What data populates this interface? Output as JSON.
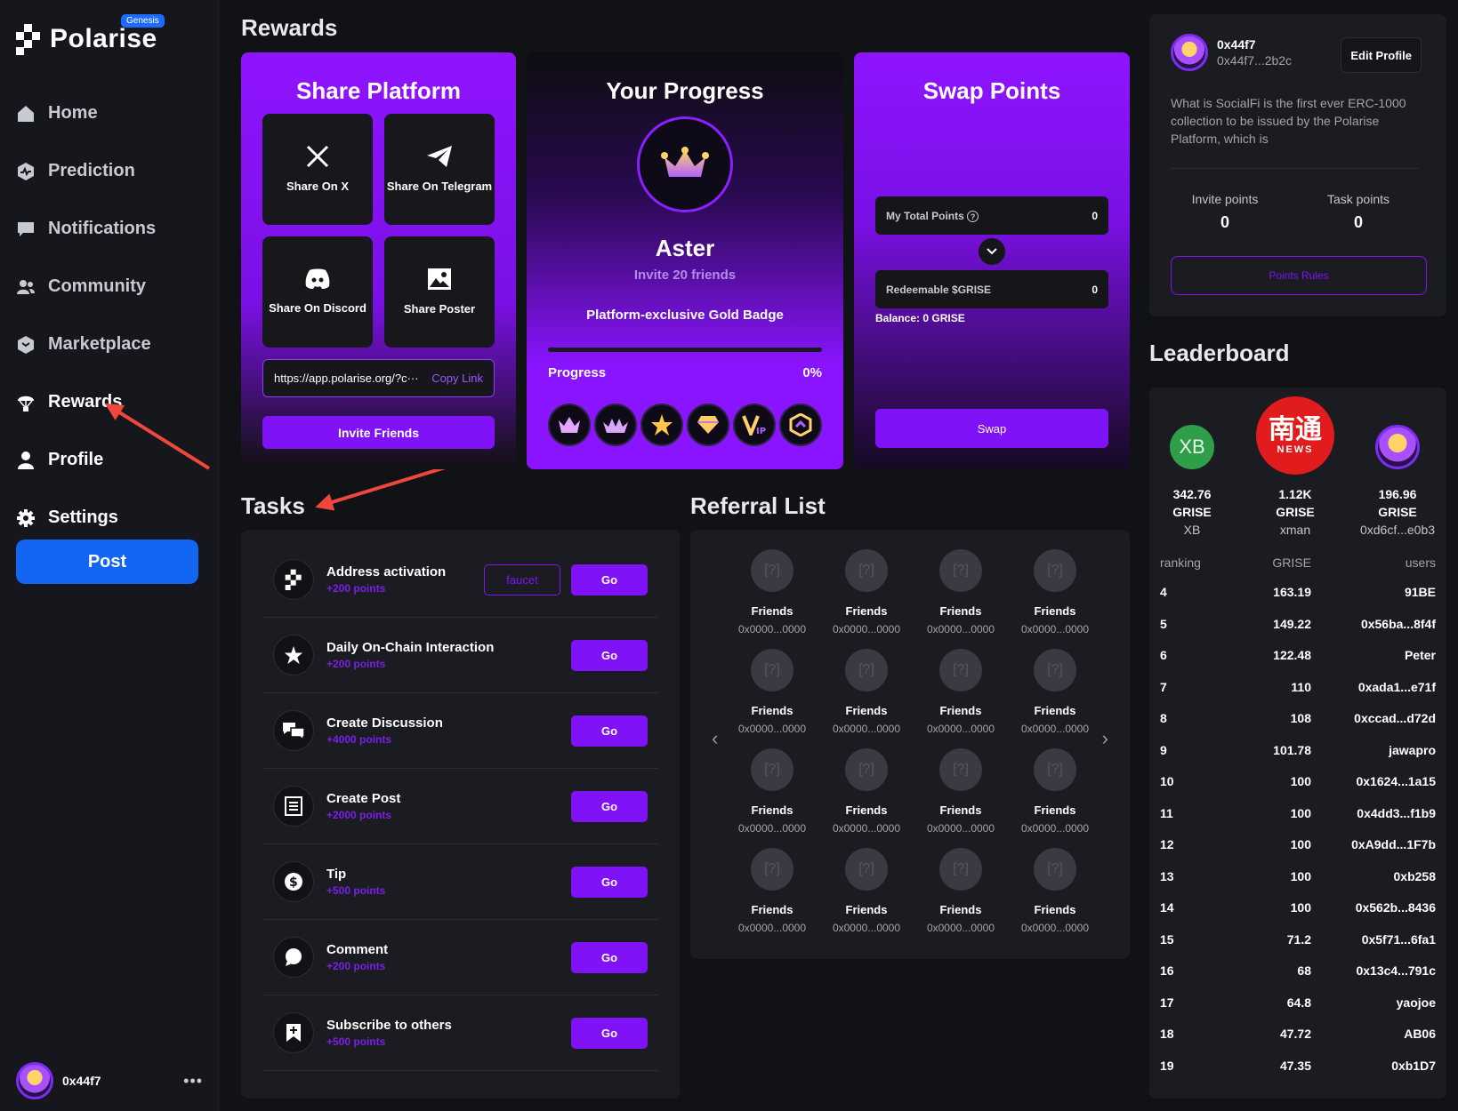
{
  "app": {
    "brand": "Polarise",
    "brand_badge": "Genesis"
  },
  "nav": [
    {
      "label": "Home",
      "icon": "home-icon"
    },
    {
      "label": "Prediction",
      "icon": "prediction-icon"
    },
    {
      "label": "Notifications",
      "icon": "notifications-icon"
    },
    {
      "label": "Community",
      "icon": "community-icon"
    },
    {
      "label": "Marketplace",
      "icon": "marketplace-icon"
    },
    {
      "label": "Rewards",
      "icon": "rewards-icon"
    },
    {
      "label": "Profile",
      "icon": "profile-icon"
    },
    {
      "label": "Settings",
      "icon": "settings-icon"
    }
  ],
  "post_label": "Post",
  "current_user": {
    "name": "0x44f7",
    "more": "•••"
  },
  "rewards": {
    "title": "Rewards",
    "share": {
      "title": "Share Platform",
      "tiles": [
        {
          "label": "Share On X",
          "icon": "x-logo-icon"
        },
        {
          "label": "Share On Telegram",
          "icon": "telegram-icon"
        },
        {
          "label": "Share On Discord",
          "icon": "discord-icon"
        },
        {
          "label": "Share Poster",
          "icon": "image-icon"
        }
      ],
      "link": "https://app.polarise.org/?c···",
      "copy_label": "Copy Link",
      "invite_label": "Invite Friends"
    },
    "progress": {
      "title": "Your Progress",
      "level": "Aster",
      "requirement": "Invite 20 friends",
      "perk": "Platform-exclusive Gold Badge",
      "progress_label": "Progress",
      "progress_value": "0%",
      "progress_fraction": 0,
      "badges": [
        "crown-badge-icon",
        "wide-crown-badge-icon",
        "star-badge-icon",
        "diamond-badge-icon",
        "vip-badge-icon",
        "hexagon-badge-icon"
      ]
    },
    "swap": {
      "title": "Swap Points",
      "total_label": "My Total Points",
      "total_value": "0",
      "redeem_label": "Redeemable $GRISE",
      "redeem_value": "0",
      "balance": "Balance:  0  GRISE",
      "swap_label": "Swap"
    }
  },
  "tasks": {
    "title": "Tasks",
    "items": [
      {
        "title": "Address activation",
        "points": "+200 points",
        "icon": "polarise-logo-icon",
        "faucet": "faucet",
        "go": "Go"
      },
      {
        "title": "Daily On-Chain Interaction",
        "points": "+200 points",
        "icon": "star-icon",
        "go": "Go"
      },
      {
        "title": "Create Discussion",
        "points": "+4000 points",
        "icon": "chat-bubbles-icon",
        "go": "Go"
      },
      {
        "title": "Create Post",
        "points": "+2000 points",
        "icon": "document-icon",
        "go": "Go"
      },
      {
        "title": "Tip",
        "points": "+500 points",
        "icon": "dollar-coin-icon",
        "go": "Go"
      },
      {
        "title": "Comment",
        "points": "+200 points",
        "icon": "comment-icon",
        "go": "Go"
      },
      {
        "title": "Subscribe to others",
        "points": "+500 points",
        "icon": "bookmark-plus-icon",
        "go": "Go"
      }
    ]
  },
  "referral": {
    "title": "Referral List",
    "item_label": "Friends",
    "item_addr": "0x0000...0000",
    "count": 16
  },
  "profile": {
    "name": "0x44f7",
    "address": "0x44f7...2b2c",
    "edit_label": "Edit Profile",
    "description": "What is SocialFi is the first ever ERC-1000 collection to be issued by the Polarise Platform, which is",
    "invite_points_label": "Invite points",
    "invite_points": "0",
    "task_points_label": "Task points",
    "task_points": "0",
    "rules_label": "Points Rules"
  },
  "leaderboard": {
    "title": "Leaderboard",
    "top": [
      {
        "avatar_text": "XB",
        "amount": "342.76",
        "unit": "GRISE",
        "name": "XB"
      },
      {
        "avatar_text": "南通",
        "avatar_sub": "NEWS",
        "amount": "1.12K",
        "unit": "GRISE",
        "name": "xman"
      },
      {
        "amount": "196.96",
        "unit": "GRISE",
        "name": "0xd6cf...e0b3"
      }
    ],
    "headers": [
      "ranking",
      "GRISE",
      "users"
    ],
    "rows": [
      [
        "4",
        "163.19",
        "91BE"
      ],
      [
        "5",
        "149.22",
        "0x56ba...8f4f"
      ],
      [
        "6",
        "122.48",
        "Peter"
      ],
      [
        "7",
        "110",
        "0xada1...e71f"
      ],
      [
        "8",
        "108",
        "0xccad...d72d"
      ],
      [
        "9",
        "101.78",
        "jawapro"
      ],
      [
        "10",
        "100",
        "0x1624...1a15"
      ],
      [
        "11",
        "100",
        "0x4dd3...f1b9"
      ],
      [
        "12",
        "100",
        "0xA9dd...1F7b"
      ],
      [
        "13",
        "100",
        "0xb258"
      ],
      [
        "14",
        "100",
        "0x562b...8436"
      ],
      [
        "15",
        "71.2",
        "0x5f71...6fa1"
      ],
      [
        "16",
        "68",
        "0x13c4...791c"
      ],
      [
        "17",
        "64.8",
        "yaojoe"
      ],
      [
        "18",
        "47.72",
        "AB06"
      ],
      [
        "19",
        "47.35",
        "0xb1D7"
      ]
    ]
  },
  "colors": {
    "accent": "#7f12f7",
    "post_button": "#1266f1",
    "background": "#111216",
    "panel": "#1b1c21",
    "annotation_arrow": "#f0473c"
  }
}
